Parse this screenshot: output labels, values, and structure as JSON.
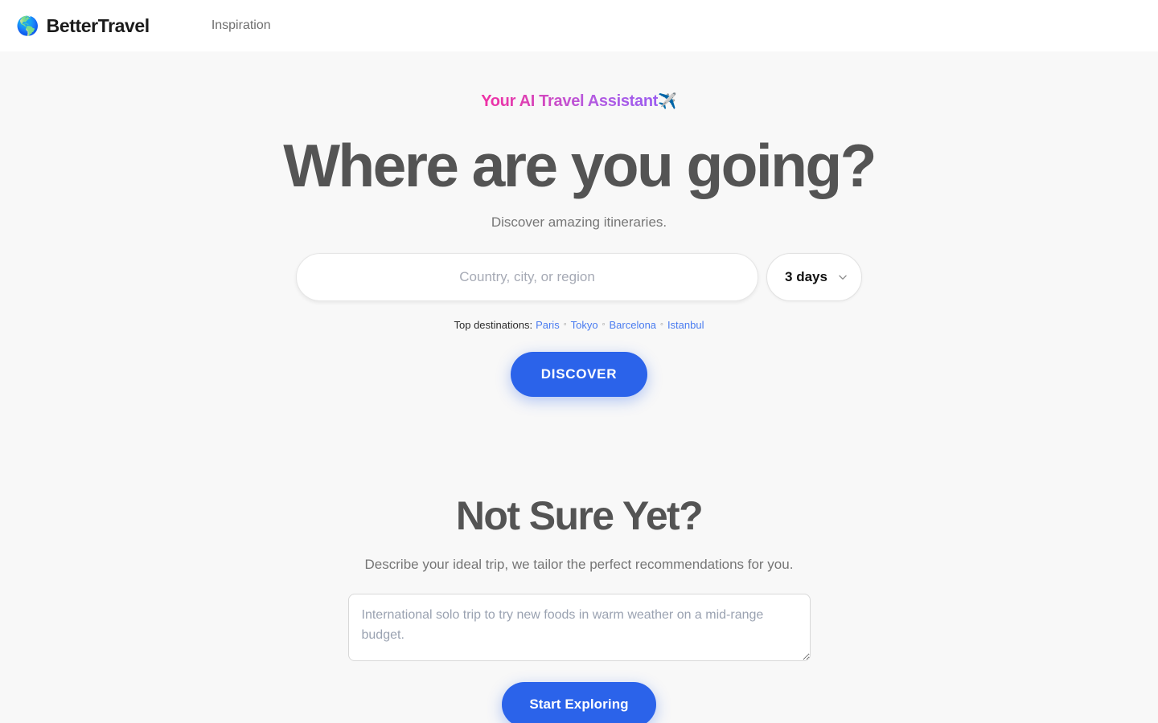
{
  "header": {
    "logo_icon": "globe-americas-icon",
    "logo_glyph": "🌎",
    "brand_name": "BetterTravel",
    "nav": [
      {
        "label": "Inspiration"
      }
    ]
  },
  "hero": {
    "tagline": "Your AI Travel Assistant",
    "tagline_emoji": "✈️",
    "tagline_gradient_from": "#f02fa5",
    "tagline_gradient_to": "#9b5cf0",
    "headline": "Where are you going?",
    "subhead": "Discover amazing itineraries.",
    "search": {
      "value": "",
      "placeholder": "Country, city, or region"
    },
    "duration": {
      "selected": "3 days",
      "icon": "chevron-down-icon",
      "options": [
        "3 days"
      ]
    },
    "top_destinations": {
      "label": "Top destinations:",
      "separator": "◦",
      "links": [
        "Paris",
        "Tokyo",
        "Barcelona",
        "Istanbul"
      ],
      "link_color": "#4a7cf0"
    },
    "discover_button": "DISCOVER"
  },
  "not_sure": {
    "heading": "Not Sure Yet?",
    "subhead": "Describe your ideal trip, we tailor the perfect recommendations for you.",
    "textarea": {
      "value": "",
      "placeholder": "International solo trip to try new foods in warm weather on a mid-range budget."
    },
    "explore_button": "Start Exploring"
  },
  "theme": {
    "accent": "#2b63ea",
    "page_bg": "#f8f8f8",
    "header_bg": "#ffffff",
    "heading_color": "#545454"
  }
}
